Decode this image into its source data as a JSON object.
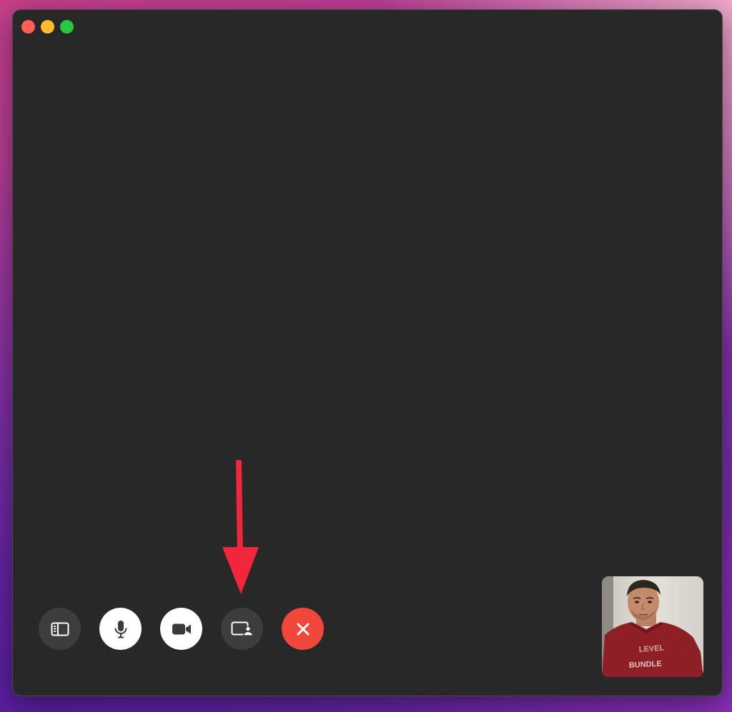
{
  "window": {
    "title": "",
    "traffic_lights": {
      "close_color": "#ff5f57",
      "minimize_color": "#febc2e",
      "maximize_color": "#28c840"
    }
  },
  "controls": [
    {
      "name": "sidebar-toggle-button",
      "icon": "sidebar-icon",
      "style": "dark"
    },
    {
      "name": "microphone-button",
      "icon": "microphone-icon",
      "style": "light"
    },
    {
      "name": "camera-button",
      "icon": "video-camera-icon",
      "style": "light"
    },
    {
      "name": "screen-share-button",
      "icon": "screen-share-icon",
      "style": "dark"
    },
    {
      "name": "end-call-button",
      "icon": "close-icon",
      "style": "end",
      "color": "#f0473a"
    }
  ],
  "self_view": {
    "content": "camera-preview"
  },
  "annotation": {
    "arrow_color": "#f0273a",
    "points_to": "screen-share-button"
  }
}
